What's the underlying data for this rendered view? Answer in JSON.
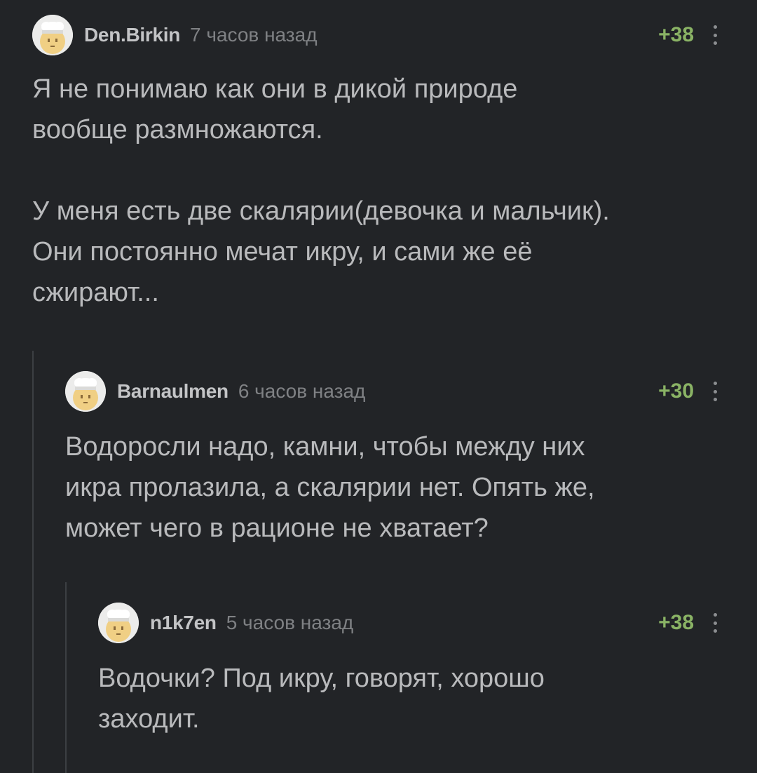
{
  "comments": [
    {
      "username": "Den.Birkin",
      "time": "7 часов назад",
      "rating": "+38",
      "text": "Я не понимаю как они в дикой природе\nвообще размножаются.\n\nУ меня есть две скалярии(девочка и мальчик).\nОни постоянно мечат икру, и сами же её\nсжирают..."
    },
    {
      "username": "Barnaulmen",
      "time": "6 часов назад",
      "rating": "+30",
      "text": "Водоросли надо, камни, чтобы между них\nикра пролазила, а скалярии нет. Опять же,\nможет чего в рационе не хватает?"
    },
    {
      "username": "n1k7en",
      "time": "5 часов назад",
      "rating": "+38",
      "text": "Водочки? Под икру, говорят, хорошо\nзаходит."
    }
  ],
  "icons": {
    "avatar": "default-avatar-icon",
    "menu": "more-vertical-icon"
  },
  "colors": {
    "background": "#222427",
    "text": "#b9babc",
    "username": "#c3c4c6",
    "timestamp": "#7f8184",
    "rating": "#8ab365",
    "thread_line": "#3c3f43"
  }
}
